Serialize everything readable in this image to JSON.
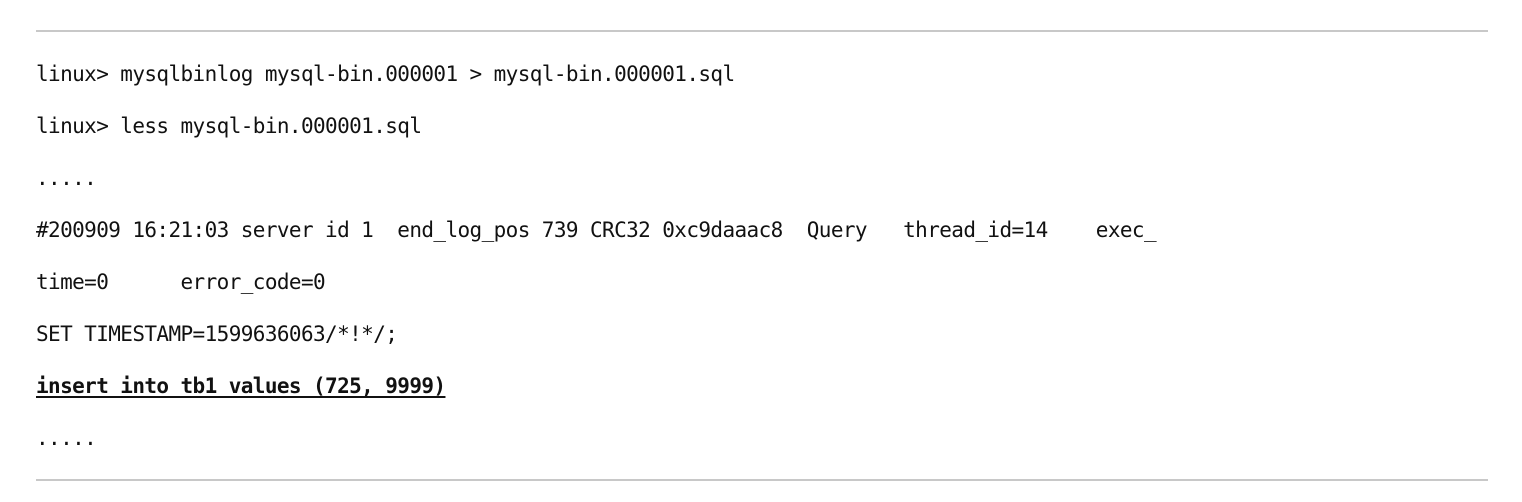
{
  "terminal": {
    "lines": [
      {
        "text": "linux> mysqlbinlog mysql-bin.000001 > mysql-bin.000001.sql",
        "style": "normal"
      },
      {
        "text": "linux> less mysql-bin.000001.sql",
        "style": "normal"
      },
      {
        "text": ".....",
        "style": "normal"
      },
      {
        "text": "#200909 16:21:03 server id 1  end_log_pos 739 CRC32 0xc9daaac8  Query   thread_id=14    exec_",
        "style": "normal"
      },
      {
        "text": "time=0      error_code=0",
        "style": "normal"
      },
      {
        "text": "SET TIMESTAMP=1599636063/*!*/;",
        "style": "normal"
      },
      {
        "text": "insert into tb1 values (725, 9999)",
        "style": "emphasis"
      },
      {
        "text": ".....",
        "style": "normal"
      }
    ]
  }
}
